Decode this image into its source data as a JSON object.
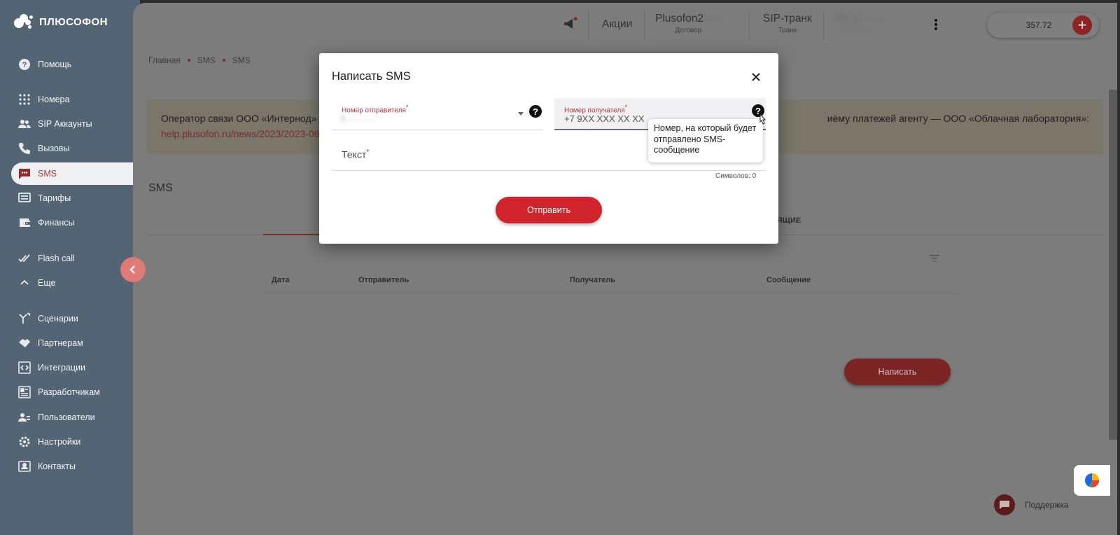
{
  "brand": {
    "name": "ПЛЮСОФОН"
  },
  "sidebar": {
    "items": [
      {
        "label": "Помощь",
        "icon": "help-circle-icon"
      },
      {
        "label": "Номера",
        "icon": "dialpad-icon"
      },
      {
        "label": "SIP Аккаунты",
        "icon": "users-icon"
      },
      {
        "label": "Вызовы",
        "icon": "phone-icon"
      },
      {
        "label": "SMS",
        "icon": "sms-icon",
        "active": true
      },
      {
        "label": "Тарифы",
        "icon": "tariff-icon"
      },
      {
        "label": "Финансы",
        "icon": "wallet-icon"
      },
      {
        "label": "Flash call",
        "icon": "double-check-icon"
      },
      {
        "label": "Еще",
        "icon": "chevron-up-icon"
      },
      {
        "label": "Сценарии",
        "icon": "branch-icon"
      },
      {
        "label": "Партнерам",
        "icon": "handshake-icon"
      },
      {
        "label": "Интеграции",
        "icon": "code-icon"
      },
      {
        "label": "Разработчикам",
        "icon": "developer-icon"
      },
      {
        "label": "Пользователи",
        "icon": "user-group-icon"
      },
      {
        "label": "Настройки",
        "icon": "gear-icon"
      },
      {
        "label": "Контакты",
        "icon": "contact-card-icon"
      }
    ]
  },
  "topbar": {
    "promo": "Акции",
    "contract": {
      "value": "Plusofon2",
      "hidden": "·····",
      "sub": "Договор"
    },
    "trunk": {
      "value": "SIP-транк",
      "sub": "Транк"
    },
    "phones": {
      "line1": "+7 (···) ···-··-··",
      "line2": "·· ······· ·"
    },
    "balance": "357.72"
  },
  "breadcrumb": [
    "Главная",
    "SMS",
    "SMS"
  ],
  "notice": {
    "text_start": "Оператор связи ООО «Интернод» с 1",
    "text_end": "иёму платежей агенту — ООО «Облачная лаборатория»:",
    "link": "help.plusofon.ru/news/2023/2023-06-2"
  },
  "page": {
    "title": "SMS",
    "tab_partial": "ДЯЩИЕ",
    "columns": [
      "Дата",
      "Отправитель",
      "Получатель",
      "Сообщение"
    ],
    "write_button": "Написать"
  },
  "support": {
    "label": "Поддержка"
  },
  "modal": {
    "title": "Написать SMS",
    "sender_label": "Номер отправителя",
    "sender_value": "7···········",
    "recipient_label": "Номер получателя",
    "recipient_placeholder": "+7 9XX XXX XX XX",
    "recipient_tooltip": "Номер, на который будет отправлено SMS-сообщение",
    "text_label": "Текст",
    "required_mark": "*",
    "char_count": "Символов: 0",
    "send_button": "Отправить"
  },
  "colors": {
    "sidebar": "#536475",
    "accent": "#d1232b",
    "overlay": "#7c7c7c"
  }
}
